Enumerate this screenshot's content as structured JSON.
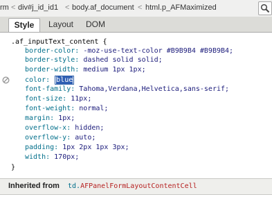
{
  "breadcrumbs": [
    "rm",
    "div#j_id_id1",
    "body.af_document",
    "html.p_AFMaximized"
  ],
  "tabs": [
    "Style",
    "Layout",
    "DOM"
  ],
  "active_tab": "Style",
  "rule": {
    "selector": ".af_inputText_content {",
    "declarations": [
      {
        "name": "border-color:",
        "value": "-moz-use-text-color #B9B9B4 #B9B9B4;"
      },
      {
        "name": "border-style:",
        "value": "dashed solid solid;"
      },
      {
        "name": "border-width:",
        "value": "medium 1px 1px;"
      },
      {
        "name": "color:",
        "value": "blue",
        "editing": true
      },
      {
        "name": "font-family:",
        "value": "Tahoma,Verdana,Helvetica,sans-serif;"
      },
      {
        "name": "font-size:",
        "value": "11px;"
      },
      {
        "name": "font-weight:",
        "value": "normal;"
      },
      {
        "name": "margin:",
        "value": "1px;"
      },
      {
        "name": "overflow-x:",
        "value": "hidden;"
      },
      {
        "name": "overflow-y:",
        "value": "auto;"
      },
      {
        "name": "padding:",
        "value": "1px 2px 1px 3px;"
      },
      {
        "name": "width:",
        "value": "170px;"
      }
    ],
    "closing": "}"
  },
  "inherited": {
    "label": "Inherited from",
    "tag": "td.",
    "class": "AFPanelFormLayoutContentCell"
  },
  "icons": {
    "search": "search-icon",
    "disable": "disable-property-icon"
  },
  "colors": {
    "property_name": "#006e8a",
    "property_value": "#1a1a7a",
    "selection": "#2f5fb3",
    "inherited_class": "#b62020"
  }
}
